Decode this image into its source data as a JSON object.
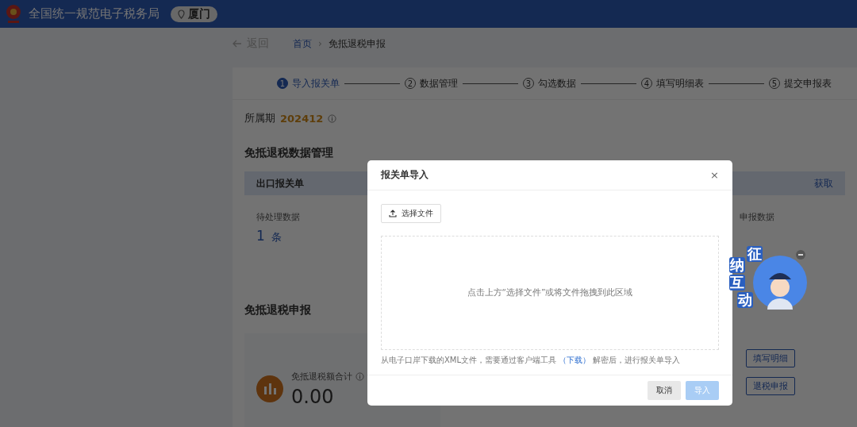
{
  "header": {
    "title": "全国统一规范电子税务局",
    "location": "厦门"
  },
  "breadcrumb": {
    "back": "返回",
    "separator": "›",
    "items": [
      {
        "label": "首页",
        "kind": "link"
      },
      {
        "label": "免抵退税申报",
        "kind": "current"
      }
    ]
  },
  "steps": [
    {
      "number": "1",
      "label": "导入报关单",
      "selected": true
    },
    {
      "number": "2",
      "label": "数据管理",
      "selected": false
    },
    {
      "number": "3",
      "label": "勾选数据",
      "selected": false
    },
    {
      "number": "4",
      "label": "填写明细表",
      "selected": false
    },
    {
      "number": "5",
      "label": "提交申报表",
      "selected": false
    }
  ],
  "period": {
    "label": "所属期",
    "value": "202412"
  },
  "data_section": {
    "title": "免抵退税数据管理",
    "card": {
      "title": "出口报关单",
      "action": "获取",
      "pending_label": "待处理数据",
      "pending_count": "1",
      "pending_unit": "条",
      "declared_label": "申报数据"
    }
  },
  "declare_section": {
    "title": "免抵退税申报",
    "total_label": "免抵退税额合计",
    "total_value": "0.00",
    "buttons": [
      "填写明细",
      "退税申报"
    ]
  },
  "dialog": {
    "title": "报关单导入",
    "close": "×",
    "upload_button": "选择文件",
    "drop_hint": "点击上方“选择文件”或将文件拖拽到此区域",
    "note_before": "从电子口岸下载的XML文件，需要通过客户端工具",
    "note_link": "（下载）",
    "note_after": "解密后，进行报关单导入",
    "buttons": [
      {
        "label": "取消",
        "disabled": false
      },
      {
        "label": "导入",
        "disabled": true
      }
    ]
  },
  "mascot": {
    "chars": [
      "征",
      "纳",
      "互",
      "动"
    ]
  }
}
